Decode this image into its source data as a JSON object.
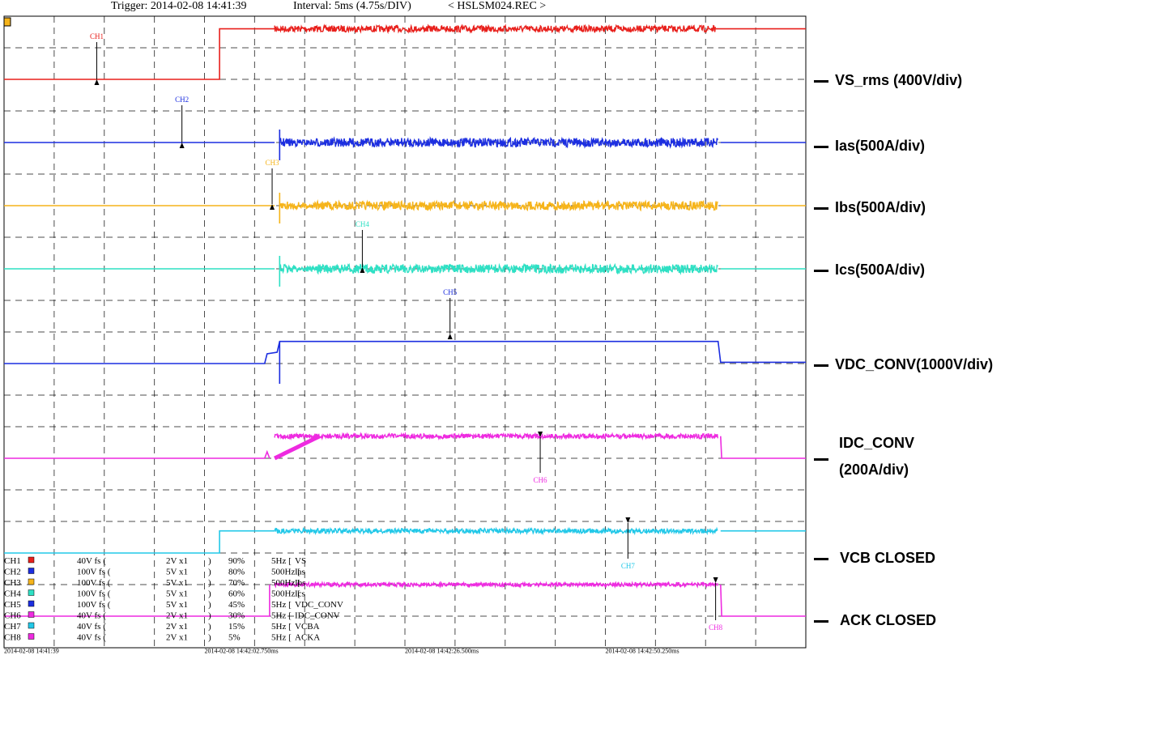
{
  "header": {
    "trigger": "Trigger: 2014-02-08 14:41:39",
    "interval": "Interval: 5ms (4.75s/DIV)",
    "file": "< HSLSM024.REC >"
  },
  "channel_table": [
    {
      "ch": "CH1",
      "color": "#e8201c",
      "fs": "40V fs (",
      "range": "2V x1",
      "close": ")",
      "pos": "90%",
      "filter": "5Hz [",
      "name": "VS"
    },
    {
      "ch": "CH2",
      "color": "#1c2ee0",
      "fs": "100V fs (",
      "range": "5V x1",
      "close": ")",
      "pos": "80%",
      "filter": "500Hz [",
      "name": "Ias"
    },
    {
      "ch": "CH3",
      "color": "#f6b41a",
      "fs": "100V fs (",
      "range": "5V x1",
      "close": ")",
      "pos": "70%",
      "filter": "500Hz [",
      "name": "Ibs"
    },
    {
      "ch": "CH4",
      "color": "#2ee0c4",
      "fs": "100V fs (",
      "range": "5V x1",
      "close": ")",
      "pos": "60%",
      "filter": "500Hz [",
      "name": "Ics"
    },
    {
      "ch": "CH5",
      "color": "#1c2ee0",
      "fs": "100V fs (",
      "range": "5V x1",
      "close": ")",
      "pos": "45%",
      "filter": "5Hz [",
      "name": "VDC_CONV"
    },
    {
      "ch": "CH6",
      "color": "#ee2ae0",
      "fs": "40V fs (",
      "range": "2V x1",
      "close": ")",
      "pos": "30%",
      "filter": "5Hz [",
      "name": "IDC_CONV"
    },
    {
      "ch": "CH7",
      "color": "#22c8e8",
      "fs": "40V fs (",
      "range": "2V x1",
      "close": ")",
      "pos": "15%",
      "filter": "5Hz [",
      "name": "VCBA"
    },
    {
      "ch": "CH8",
      "color": "#ee2ae0",
      "fs": "40V fs (",
      "range": "2V x1",
      "close": ")",
      "pos": "5%",
      "filter": "5Hz [",
      "name": "ACKA"
    }
  ],
  "right_labels": [
    {
      "text": "VS_rms (400V/div)"
    },
    {
      "text": "Ias(500A/div)"
    },
    {
      "text": "Ibs(500A/div)"
    },
    {
      "text": "Ics(500A/div)"
    },
    {
      "text": "VDC_CONV(1000V/div)"
    },
    {
      "text": "IDC_CONV",
      "text2": "(200A/div)"
    },
    {
      "text": "VCB CLOSED"
    },
    {
      "text": "ACK CLOSED"
    }
  ],
  "chart_data": {
    "type": "line",
    "grid": true,
    "time_ticks": [
      "2014-02-08 14:41:39",
      "2014-02-08 14:42:02.750ms",
      "2014-02-08 14:42:26.500ms",
      "2014-02-08 14:42:50.250ms"
    ],
    "x_divisions": 16,
    "y_divisions": 20,
    "series": [
      {
        "name": "CH1",
        "color": "#e8201c",
        "levels_pct": [
          90,
          98
        ],
        "steps_div": [
          4.3,
          5.4,
          14.2
        ],
        "noise": "on"
      },
      {
        "name": "CH2",
        "color": "#1c2ee0",
        "levels_pct": [
          80
        ],
        "steps_div": [
          5.4,
          6.1,
          14.2
        ],
        "noise": "current"
      },
      {
        "name": "CH3",
        "color": "#f6b41a",
        "levels_pct": [
          70
        ],
        "steps_div": [
          5.4,
          6.1,
          14.2
        ],
        "noise": "current"
      },
      {
        "name": "CH4",
        "color": "#2ee0c4",
        "levels_pct": [
          60
        ],
        "steps_div": [
          5.4,
          6.1,
          14.2
        ],
        "noise": "current"
      },
      {
        "name": "CH5",
        "color": "#1c2ee0",
        "levels_pct": [
          45,
          48.5,
          45.2
        ],
        "steps_div": [
          5.4,
          14.2
        ],
        "noise": "low"
      },
      {
        "name": "CH6",
        "color": "#ee2ae0",
        "levels_pct": [
          30,
          33.5,
          30
        ],
        "steps_div": [
          5.4,
          6.3,
          14.2
        ],
        "noise": "ramp"
      },
      {
        "name": "CH7",
        "color": "#22c8e8",
        "levels_pct": [
          15,
          18.5
        ],
        "steps_div": [
          4.3,
          5.4,
          14.2
        ],
        "noise": "on"
      },
      {
        "name": "CH8",
        "color": "#ee2ae0",
        "levels_pct": [
          5,
          10
        ],
        "steps_div": [
          5.3,
          14.2
        ],
        "noise": "step"
      }
    ]
  }
}
